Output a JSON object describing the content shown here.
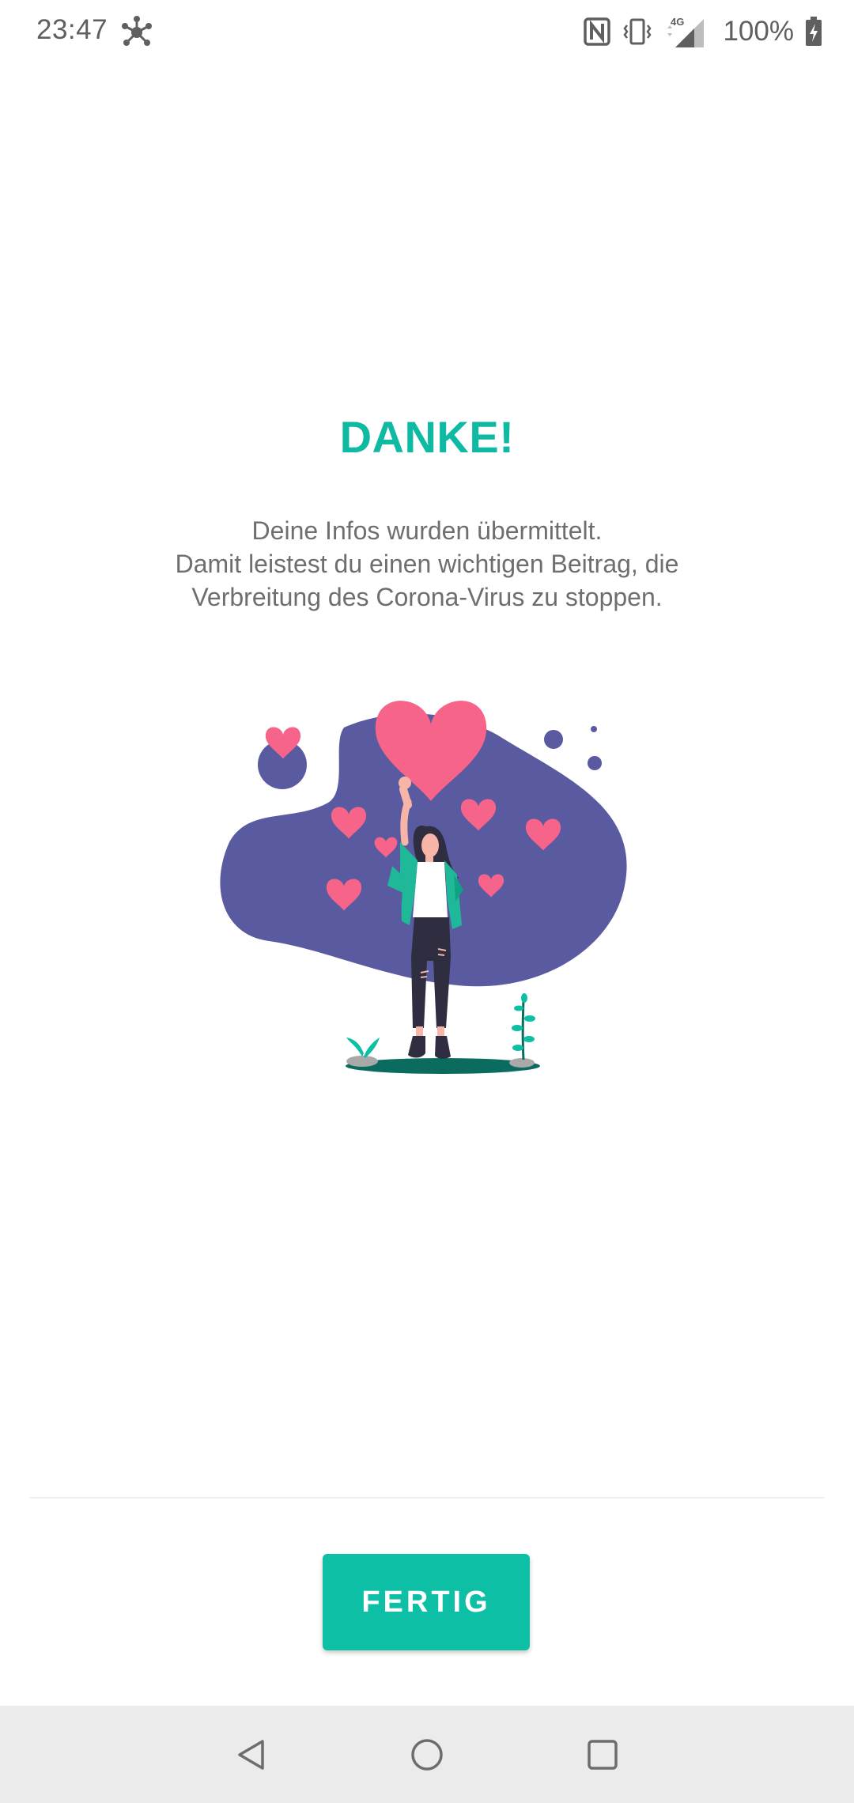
{
  "status_bar": {
    "time": "23:47",
    "battery": "100%",
    "icons": [
      "network-hub-icon",
      "nfc-icon",
      "vibrate-icon",
      "signal-4g-icon",
      "battery-charging-icon"
    ]
  },
  "content": {
    "title": "DANKE!",
    "message_lines": [
      "Deine Infos wurden übermittelt.",
      "Damit leistest du einen wichtigen Beitrag, die",
      "Verbreitung des Corona-Virus zu stoppen."
    ],
    "signal_label": "4G"
  },
  "actions": {
    "done_label": "FERTIG"
  },
  "navigation": {
    "buttons": [
      "back-icon",
      "home-icon",
      "recents-icon"
    ]
  },
  "colors": {
    "accent": "#0fbaa3",
    "blob": "#5a5aa0",
    "heart": "#f7648a",
    "navbar": "#ebebeb"
  }
}
